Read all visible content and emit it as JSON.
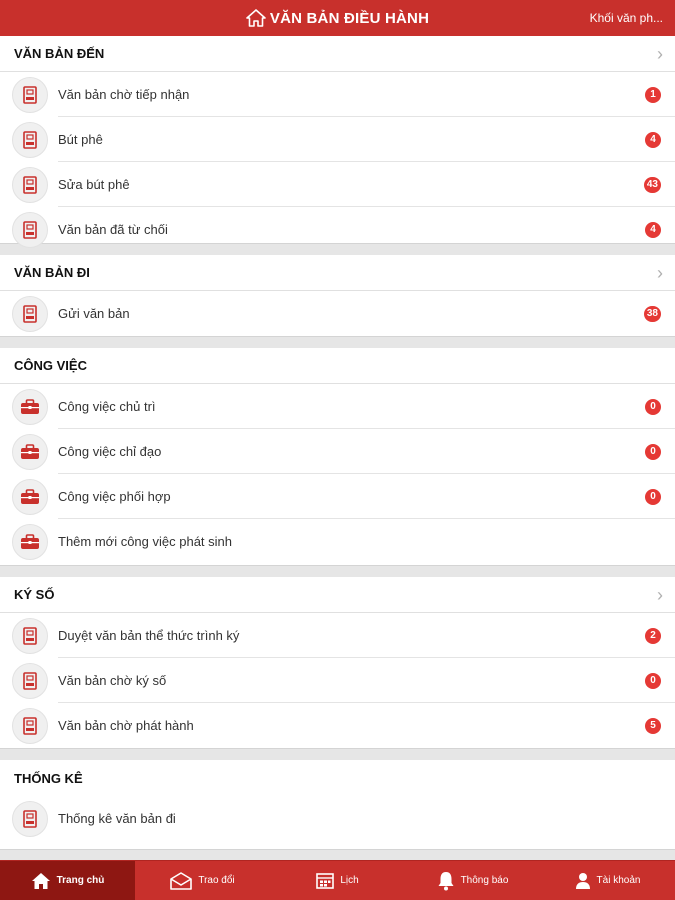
{
  "header": {
    "title": "VĂN BẢN ĐIỀU HÀNH",
    "org": "Khối văn ph..."
  },
  "sections": [
    {
      "title": "VĂN BẢN ĐẾN",
      "items": [
        {
          "label": "Văn bản chờ tiếp nhận",
          "badge": "1"
        },
        {
          "label": "Bút phê",
          "badge": "4"
        },
        {
          "label": "Sửa bút phê",
          "badge": "43"
        },
        {
          "label": "Văn bản đã từ chối",
          "badge": "4"
        }
      ]
    },
    {
      "title": "VĂN BẢN ĐI",
      "items": [
        {
          "label": "Gửi văn bản",
          "badge": "38"
        }
      ]
    },
    {
      "title": "CÔNG VIỆC",
      "items": [
        {
          "label": "Công việc chủ trì",
          "badge": "0"
        },
        {
          "label": "Công việc chỉ đạo",
          "badge": "0"
        },
        {
          "label": "Công việc phối hợp",
          "badge": "0"
        },
        {
          "label": "Thêm mới công việc phát sinh"
        }
      ]
    },
    {
      "title": "KÝ SỐ",
      "items": [
        {
          "label": "Duyệt văn bản thể thức trình ký",
          "badge": "2"
        },
        {
          "label": "Văn bản chờ ký số",
          "badge": "0"
        },
        {
          "label": "Văn bản chờ phát hành",
          "badge": "5"
        }
      ]
    },
    {
      "title": "THỐNG KÊ",
      "items": [
        {
          "label": "Thống kê văn bản đi"
        }
      ]
    }
  ],
  "tabs": [
    {
      "label": "Trang chủ",
      "icon": "home-icon",
      "active": true
    },
    {
      "label": "Trao đổi",
      "icon": "mail-icon"
    },
    {
      "label": "Lịch",
      "icon": "calendar-icon"
    },
    {
      "label": "Thông báo",
      "icon": "bell-icon"
    },
    {
      "label": "Tài khoản",
      "icon": "user-icon"
    }
  ],
  "colors": {
    "brand_red": "#c8302c",
    "active_tab": "#8e1712",
    "badge_red": "#e53935"
  }
}
